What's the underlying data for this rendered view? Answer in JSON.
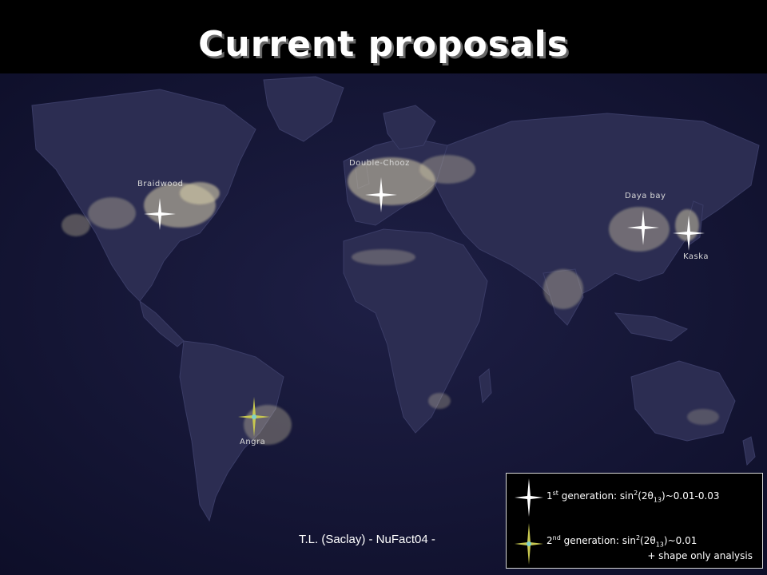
{
  "slide": {
    "title": "Current proposals",
    "footer": "T.L. (Saclay) - NuFact04 -"
  },
  "sites": [
    {
      "label": "Braidwood",
      "generation": "1st",
      "icon": "four-point-star-icon"
    },
    {
      "label": "Double-Chooz",
      "generation": "1st",
      "icon": "four-point-star-icon"
    },
    {
      "label": "Daya bay",
      "generation": "1st",
      "icon": "four-point-star-icon"
    },
    {
      "label": "Kaska",
      "generation": "1st",
      "icon": "four-point-star-icon"
    },
    {
      "label": "Angra",
      "generation": "2nd",
      "icon": "four-point-star-icon"
    }
  ],
  "legend": {
    "first": {
      "ord": "1",
      "ord_sup": "st",
      "text_a": "generation: sin",
      "sup2": "2",
      "text_b": "(2",
      "theta": "θ",
      "sub": "13",
      "text_c": ")~0.01-0.03"
    },
    "second": {
      "ord": "2",
      "ord_sup": "nd",
      "text_a": "generation: sin",
      "sup2": "2",
      "text_b": "(2",
      "theta": "θ",
      "sub": "13",
      "text_c": ")~0.01"
    },
    "second_extra": "+ shape only analysis"
  },
  "colors": {
    "first_generation_star": "#ffffff",
    "second_generation_star": "#c8c850",
    "second_generation_center": "#7fd0c8"
  }
}
